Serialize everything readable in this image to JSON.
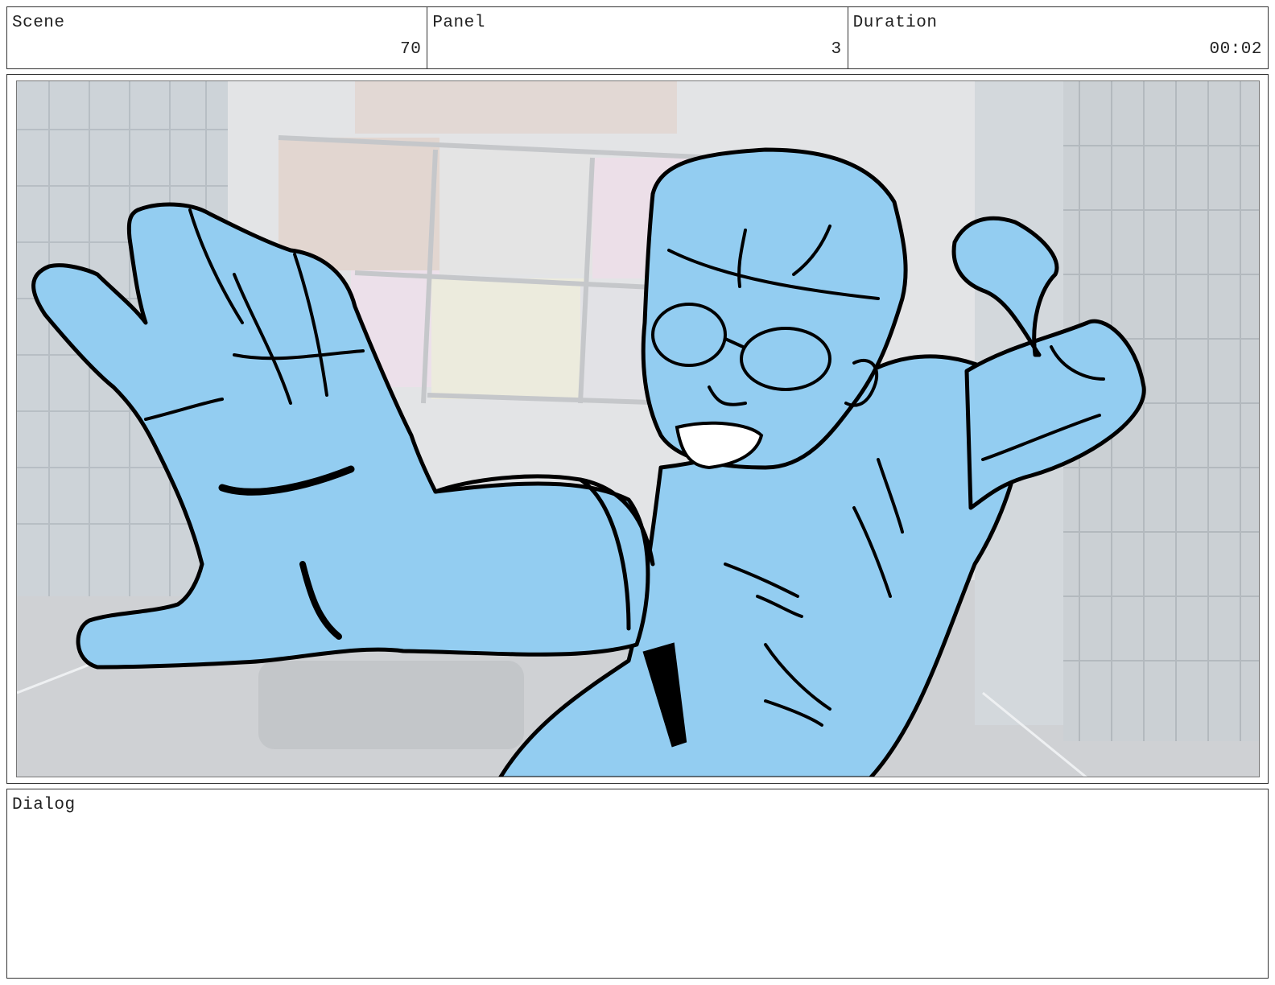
{
  "header": {
    "scene": {
      "label": "Scene",
      "value": "70"
    },
    "panel": {
      "label": "Panel",
      "value": "3"
    },
    "duration": {
      "label": "Duration",
      "value": "00:02"
    }
  },
  "artwork": {
    "fill_color": "#93cdf1",
    "line_color": "#000000",
    "background_tone": "#dcdee0"
  },
  "dialog": {
    "label": "Dialog",
    "text": ""
  }
}
